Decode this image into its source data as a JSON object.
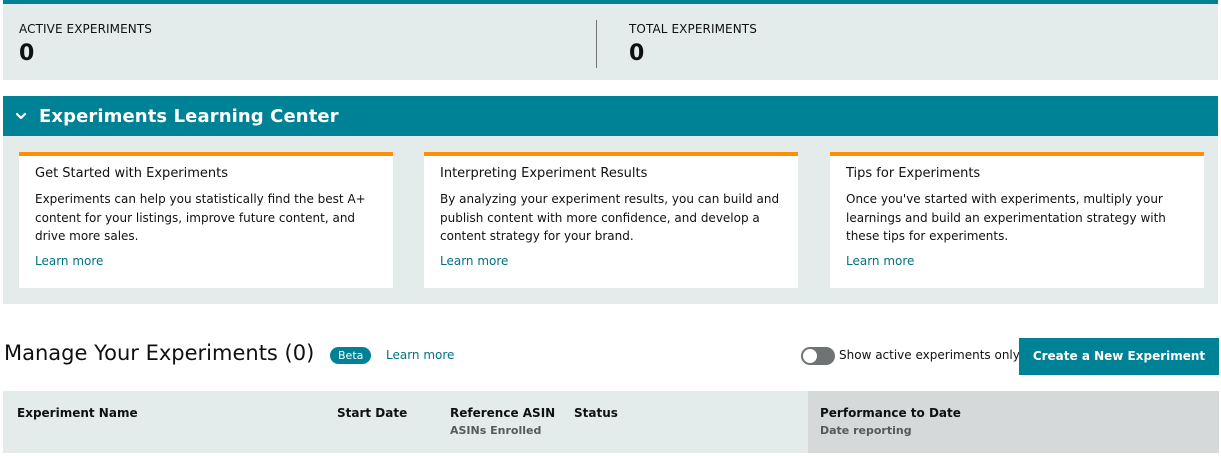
{
  "stats": {
    "active_label": "ACTIVE EXPERIMENTS",
    "active_value": "0",
    "total_label": "TOTAL EXPERIMENTS",
    "total_value": "0"
  },
  "learning_center": {
    "title": "Experiments Learning Center",
    "chevron_icon": "chevron-down-icon",
    "cards": [
      {
        "title": "Get Started with Experiments",
        "body": "Experiments can help you statistically find the best A+ content for your listings, improve future content, and drive more sales.",
        "link": "Learn more"
      },
      {
        "title": "Interpreting Experiment Results",
        "body": "By analyzing your experiment results, you can build and publish content with more confidence, and develop a content strategy for your brand.",
        "link": "Learn more"
      },
      {
        "title": "Tips for Experiments",
        "body": "Once you've started with experiments, multiply your learnings and build an experimentation strategy with these tips for experiments.",
        "link": "Learn more"
      }
    ]
  },
  "manage": {
    "title": "Manage Your Experiments (0)",
    "badge": "Beta",
    "learn_more": "Learn more",
    "toggle_label": "Show active experiments only",
    "toggle_on": false,
    "create_button": "Create a New Experiment"
  },
  "table": {
    "columns": [
      {
        "label": "Experiment Name",
        "sub": ""
      },
      {
        "label": "Start Date",
        "sub": ""
      },
      {
        "label": "Reference ASIN",
        "sub": "ASINs Enrolled"
      },
      {
        "label": "Status",
        "sub": ""
      },
      {
        "label": "Performance to Date",
        "sub": "Date reporting"
      }
    ]
  },
  "colors": {
    "teal": "#008296",
    "orange": "#ff8f00",
    "panel_bg": "#e3ebeb",
    "link": "#007185"
  }
}
